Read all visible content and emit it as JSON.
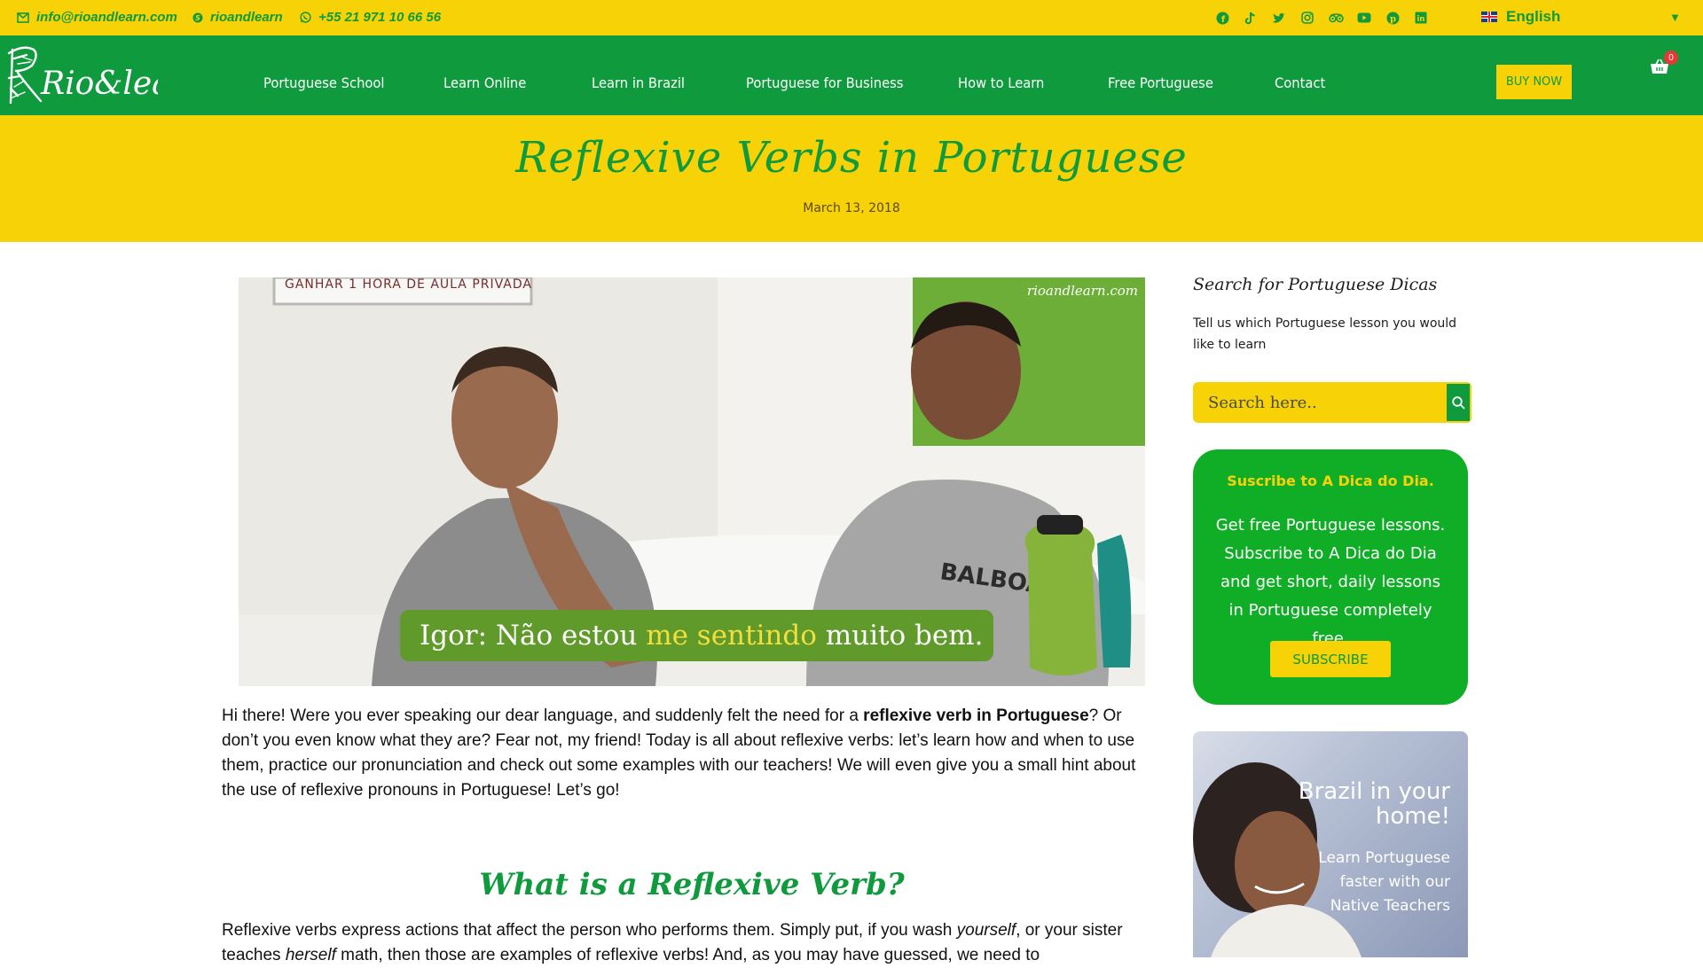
{
  "topbar": {
    "email": "info@rioandlearn.com",
    "skype": "rioandlearn",
    "whatsapp": "+55 21 971 10 66 56",
    "social_icons": [
      "facebook-icon",
      "tiktok-icon",
      "twitter-icon",
      "instagram-icon",
      "tripadvisor-icon",
      "youtube-icon",
      "pinterest-icon",
      "linkedin-icon"
    ],
    "language": "English"
  },
  "nav": {
    "items": [
      "Portuguese School",
      "Learn Online",
      "Learn in Brazil",
      "Portuguese for Business",
      "How to Learn",
      "Free Portuguese",
      "Contact"
    ],
    "buy_now": "BUY NOW",
    "cart_count": "0"
  },
  "logo_text": "Rio&learn",
  "hero": {
    "title": "Reflexive Verbs in Portuguese",
    "date": "March 13, 2018"
  },
  "feature_image": {
    "watermark": "rioandlearn.com",
    "whiteboard": "GANHAR 1 HORA DE AULA PRIVADA",
    "subtitle_prefix": "Igor: Não estou ",
    "subtitle_highlight": "me sentindo",
    "subtitle_suffix": " muito bem."
  },
  "article": {
    "intro_before": "Hi there! Were you ever speaking our dear language, and suddenly felt the need for a ",
    "intro_bold": "reflexive verb in Portuguese",
    "intro_after": "? Or don’t you even know what they are? Fear not, my friend! Today is all about reflexive verbs: let’s learn how and when to use them, practice our pronunciation and check out some examples with our teachers! We will even give you a small hint about the use of reflexive pronouns in Portuguese! Let’s go!",
    "h2": "What is a Reflexive Verb?",
    "p2_a": "Reflexive verbs express actions that affect the person who performs them. Simply put, if you wash ",
    "p2_i1": "yourself",
    "p2_b": ", or your sister teaches ",
    "p2_i2": "herself",
    "p2_c": " math, then those are examples of reflexive verbs! And, as you may have guessed, we need to"
  },
  "sidebar": {
    "search_title": "Search for Portuguese Dicas",
    "search_text": "Tell us which Portuguese lesson you would like to learn",
    "search_placeholder": "Search here..",
    "subscribe_title": "Suscribe to A Dica do Dia.",
    "subscribe_text": "Get free Portuguese lessons. Subscribe to A Dica do Dia and get short, daily lessons in Portuguese completely free.",
    "subscribe_button": "SUBSCRIBE",
    "promo_title": "Brazil in your home!",
    "promo_text": "Learn Portuguese faster with our Native Teachers"
  },
  "colors": {
    "brand_green": "#0f9a3d",
    "brand_yellow": "#f7d207",
    "subscribe_green": "#0fae26"
  }
}
